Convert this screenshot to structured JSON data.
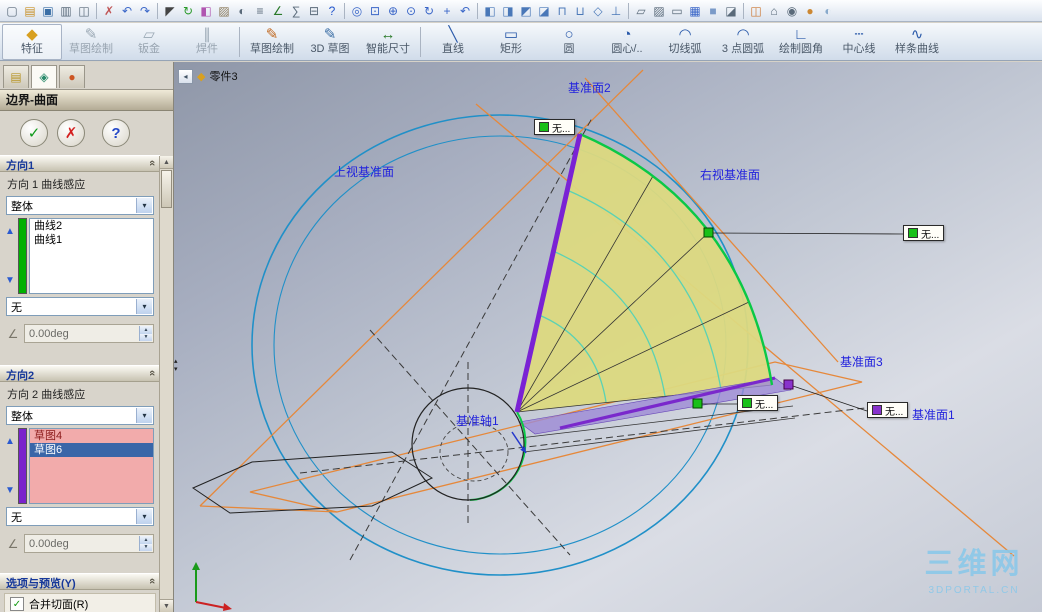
{
  "colors": {
    "selection_green": "#00b000",
    "selection_purple": "#7a22cc",
    "surface_yellow": "#dcd97f",
    "curve_green": "#0ac846",
    "edge_purple": "#7a22d4",
    "plane_edge_orange": "#e6883a",
    "sketch_circle_blue": "#2090c8",
    "label_blue": "#2222dd",
    "list_highlight_pink": "#f2abab",
    "watermark_blue": "#8cc8e8"
  },
  "toolbar1": {
    "icons": [
      {
        "name": "new-document-icon",
        "glyph": "▢",
        "color": "#5a6a7a"
      },
      {
        "name": "open-icon",
        "glyph": "▤",
        "color": "#c8922a"
      },
      {
        "name": "save-icon",
        "glyph": "▣",
        "color": "#3a6ea5"
      },
      {
        "name": "print-icon",
        "glyph": "▥",
        "color": "#5a6a7a"
      },
      {
        "name": "print-preview-icon",
        "glyph": "◫",
        "color": "#5a6a7a"
      },
      {
        "type": "sep"
      },
      {
        "name": "delete-icon",
        "glyph": "✗",
        "color": "#c05555"
      },
      {
        "name": "undo-icon",
        "glyph": "↶",
        "color": "#3a66c8"
      },
      {
        "name": "redo-icon",
        "glyph": "↷",
        "color": "#3a66c8"
      },
      {
        "type": "sep"
      },
      {
        "name": "select-icon",
        "glyph": "◤",
        "color": "#444444"
      },
      {
        "name": "rebuild-icon",
        "glyph": "↻",
        "color": "#2a9a2a"
      },
      {
        "name": "edit-color-icon",
        "glyph": "◧",
        "color": "#b055b0"
      },
      {
        "name": "texture-icon",
        "glyph": "▨",
        "color": "#8a7a5a"
      },
      {
        "name": "display-settings-icon",
        "glyph": "◐",
        "color": "#5a6a7a"
      },
      {
        "name": "options-icon",
        "glyph": "≡",
        "color": "#5a6a7a"
      },
      {
        "name": "measure-icon",
        "glyph": "∠",
        "color": "#2a7a2a"
      },
      {
        "name": "mass-properties-icon",
        "glyph": "∑",
        "color": "#5a6a7a"
      },
      {
        "name": "section-properties-icon",
        "glyph": "⊟",
        "color": "#5a6a7a"
      },
      {
        "name": "help-icon",
        "glyph": "?",
        "color": "#2255cc"
      },
      {
        "type": "sep"
      },
      {
        "name": "zoom-to-fit-icon",
        "glyph": "◎",
        "color": "#3a66c8"
      },
      {
        "name": "zoom-area-icon",
        "glyph": "⊡",
        "color": "#3a66c8"
      },
      {
        "name": "zoom-in-out-icon",
        "glyph": "⊕",
        "color": "#3a66c8"
      },
      {
        "name": "zoom-to-selection-icon",
        "glyph": "⊙",
        "color": "#3a66c8"
      },
      {
        "name": "rotate-view-icon",
        "glyph": "↻",
        "color": "#3a66c8"
      },
      {
        "name": "pan-icon",
        "glyph": "+",
        "color": "#3a66c8"
      },
      {
        "name": "previous-view-icon",
        "glyph": "↶",
        "color": "#3a66c8"
      },
      {
        "type": "sep"
      },
      {
        "name": "front-view-icon",
        "glyph": "◧",
        "color": "#4a78b8"
      },
      {
        "name": "back-view-icon",
        "glyph": "◨",
        "color": "#4a78b8"
      },
      {
        "name": "left-view-icon",
        "glyph": "◩",
        "color": "#4a78b8"
      },
      {
        "name": "right-view-icon",
        "glyph": "◪",
        "color": "#4a78b8"
      },
      {
        "name": "top-view-icon",
        "glyph": "⊓",
        "color": "#4a78b8"
      },
      {
        "name": "bottom-view-icon",
        "glyph": "⊔",
        "color": "#4a78b8"
      },
      {
        "name": "isometric-view-icon",
        "glyph": "◇",
        "color": "#4a78b8"
      },
      {
        "name": "normal-to-icon",
        "glyph": "⊥",
        "color": "#4a78b8"
      },
      {
        "type": "sep"
      },
      {
        "name": "wireframe-icon",
        "glyph": "▱",
        "color": "#5a6a7a"
      },
      {
        "name": "hidden-lines-visible-icon",
        "glyph": "▨",
        "color": "#5a6a7a"
      },
      {
        "name": "hidden-lines-removed-icon",
        "glyph": "▭",
        "color": "#5a6a7a"
      },
      {
        "name": "shaded-with-edges-icon",
        "glyph": "▦",
        "color": "#3a66c8"
      },
      {
        "name": "shaded-icon",
        "glyph": "■",
        "color": "#7a9ac8"
      },
      {
        "name": "shadows-icon",
        "glyph": "◪",
        "color": "#5a6a7a"
      },
      {
        "type": "sep"
      },
      {
        "name": "section-view-icon",
        "glyph": "◫",
        "color": "#cc7733"
      },
      {
        "name": "view-orientation-icon",
        "glyph": "⌂",
        "color": "#5a6a7a"
      },
      {
        "name": "camera-icon",
        "glyph": "◉",
        "color": "#5a6a7a"
      },
      {
        "name": "appearance-icon",
        "glyph": "●",
        "color": "#cc8833"
      },
      {
        "name": "scene-icon",
        "glyph": "◐",
        "color": "#88aacc"
      }
    ]
  },
  "toolbar2": {
    "buttons": [
      {
        "name": "features-tab-button",
        "label": "特征",
        "glyph": "◆",
        "color": "#d8a020",
        "pressed": true
      },
      {
        "name": "sketch-tab-button",
        "label": "草图绘制",
        "glyph": "✎",
        "color": "#9aa8b4",
        "enabled": false
      },
      {
        "name": "sheet-metal-tab-button",
        "label": "钣金",
        "glyph": "▱",
        "color": "#9aa8b4",
        "enabled": false
      },
      {
        "name": "weldments-tab-button",
        "label": "焊件",
        "glyph": "∥",
        "color": "#9aa8b4",
        "enabled": false
      },
      {
        "type": "sep"
      },
      {
        "name": "sketch-button",
        "label": "草图绘制",
        "glyph": "✎",
        "color": "#c06820"
      },
      {
        "name": "sketch-3d-button",
        "label": "3D 草图",
        "glyph": "✎",
        "color": "#3a6ea5"
      },
      {
        "name": "smart-dimension-button",
        "label": "智能尺寸",
        "glyph": "↔",
        "color": "#2a7a2a"
      },
      {
        "type": "sep"
      },
      {
        "name": "line-button",
        "label": "直线",
        "glyph": "╲",
        "color": "#2a5aaa"
      },
      {
        "name": "rectangle-button",
        "label": "矩形",
        "glyph": "▭",
        "color": "#2a5aaa"
      },
      {
        "name": "circle-button",
        "label": "圆",
        "glyph": "○",
        "color": "#2a5aaa"
      },
      {
        "name": "centerpoint-arc-button",
        "label": "圆心/..",
        "glyph": "◔",
        "color": "#2a5aaa"
      },
      {
        "name": "tangent-arc-button",
        "label": "切线弧",
        "glyph": "◠",
        "color": "#2a5aaa"
      },
      {
        "name": "three-point-arc-button",
        "label": "3 点圆弧",
        "glyph": "◠",
        "color": "#2a5aaa"
      },
      {
        "name": "sketch-fillet-button",
        "label": "绘制圆角",
        "glyph": "∟",
        "color": "#2a5aaa"
      },
      {
        "name": "centerline-button",
        "label": "中心线",
        "glyph": "┄",
        "color": "#2a5aaa"
      },
      {
        "name": "spline-button",
        "label": "样条曲线",
        "glyph": "∿",
        "color": "#2a5aaa"
      }
    ]
  },
  "panel": {
    "title": "边界-曲面",
    "dir1": {
      "header": "方向1",
      "sense_label": "方向 1 曲线感应",
      "sense_value": "整体",
      "items": [
        "曲线2",
        "曲线1"
      ],
      "tangent_value": "无",
      "angle_value": "0.00deg"
    },
    "dir2": {
      "header": "方向2",
      "sense_label": "方向 2 曲线感应",
      "sense_value": "整体",
      "items": [
        {
          "label": "草图4",
          "state": "hl"
        },
        {
          "label": "草图6",
          "state": "sel"
        }
      ],
      "tangent_value": "无",
      "angle_value": "0.00deg"
    },
    "options": {
      "header": "选项与预览(Y)",
      "merge_label": "合并切面(R)",
      "merged": true
    }
  },
  "viewport": {
    "tree_item": "零件3",
    "labels": {
      "plane2": "基准面2",
      "top_plane": "上视基准面",
      "right_plane": "右视基准面",
      "plane3": "基准面3",
      "plane1": "基准面1",
      "axis1": "基准轴1"
    },
    "callouts": {
      "c1": "无...",
      "c2": "无...",
      "c3": "无...",
      "c4": "无..."
    },
    "watermark_title": "三维网",
    "watermark_sub": "3DPORTAL.CN"
  }
}
